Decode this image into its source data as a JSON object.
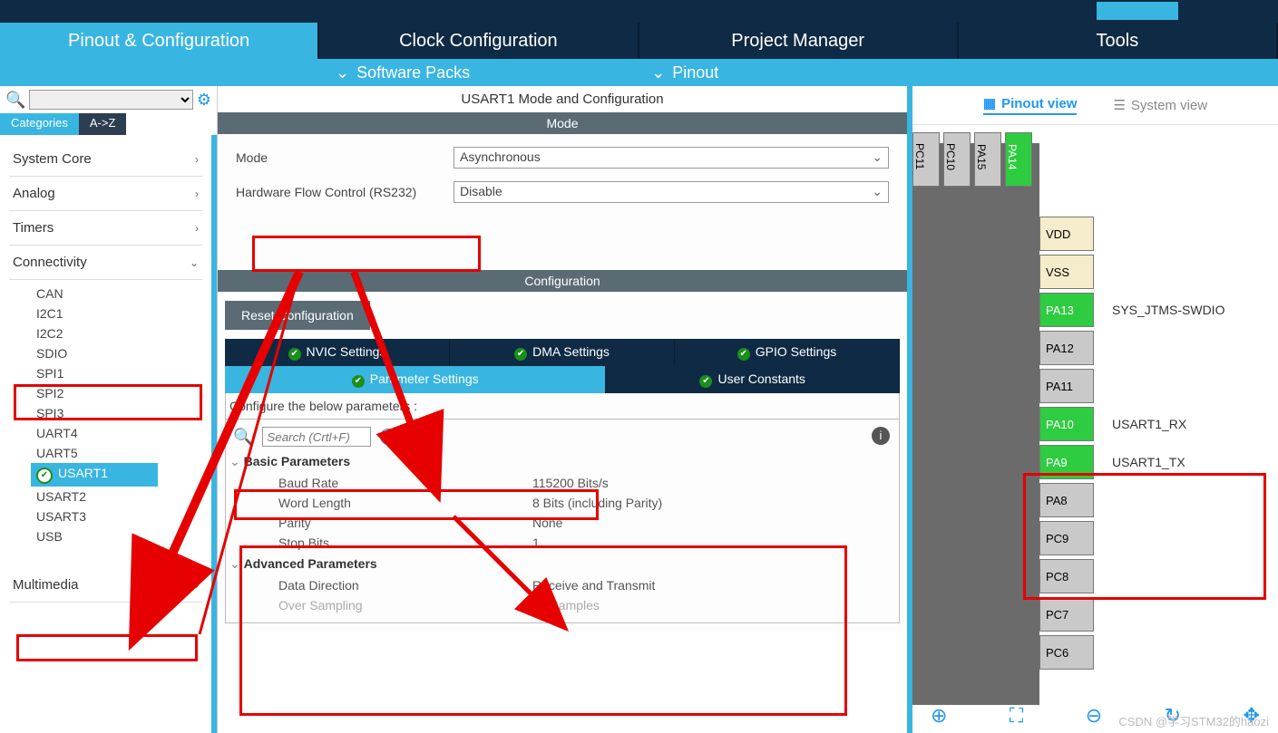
{
  "tabs": {
    "pinout": "Pinout & Configuration",
    "clock": "Clock Configuration",
    "project": "Project Manager",
    "tools": "Tools"
  },
  "subbar": {
    "software_packs": "Software Packs",
    "pinout": "Pinout"
  },
  "left": {
    "cat_tabs": {
      "categories": "Categories",
      "az": "A->Z"
    },
    "groups": {
      "system_core": "System Core",
      "analog": "Analog",
      "timers": "Timers",
      "connectivity": "Connectivity",
      "multimedia": "Multimedia"
    },
    "connectivity_items": [
      "CAN",
      "I2C1",
      "I2C2",
      "SDIO",
      "SPI1",
      "SPI2",
      "SPI3",
      "UART4",
      "UART5",
      "USART1",
      "USART2",
      "USART3",
      "USB"
    ]
  },
  "center": {
    "title": "USART1 Mode and Configuration",
    "mode_header": "Mode",
    "mode_label": "Mode",
    "mode_value": "Asynchronous",
    "hw_label": "Hardware Flow Control (RS232)",
    "hw_value": "Disable",
    "config_header": "Configuration",
    "reset_btn": "Reset Configuration",
    "cfg_tabs_row1": [
      "NVIC Settings",
      "DMA Settings",
      "GPIO Settings"
    ],
    "cfg_tabs_row2": [
      "Parameter Settings",
      "User Constants"
    ],
    "cfg_hint": "Configure the below parameters :",
    "search_placeholder": "Search (Crtl+F)",
    "groups": {
      "basic": {
        "title": "Basic Parameters",
        "rows": [
          {
            "name": "Baud Rate",
            "value": "115200 Bits/s"
          },
          {
            "name": "Word Length",
            "value": "8 Bits (including Parity)"
          },
          {
            "name": "Parity",
            "value": "None"
          },
          {
            "name": "Stop Bits",
            "value": "1"
          }
        ]
      },
      "advanced": {
        "title": "Advanced Parameters",
        "rows": [
          {
            "name": "Data Direction",
            "value": "Receive and Transmit"
          },
          {
            "name": "Over Sampling",
            "value": "16 Samples",
            "dim": true
          }
        ]
      }
    }
  },
  "right": {
    "pinout_view": "Pinout view",
    "system_view": "System view",
    "top_pins": [
      {
        "label": "PC11",
        "green": false
      },
      {
        "label": "PC10",
        "green": false
      },
      {
        "label": "PA15",
        "green": false
      },
      {
        "label": "PA14",
        "green": true
      }
    ],
    "side_pins": [
      {
        "label": "VDD",
        "cls": "yellow",
        "fn": ""
      },
      {
        "label": "VSS",
        "cls": "yellow",
        "fn": ""
      },
      {
        "label": "PA13",
        "cls": "green",
        "fn": "SYS_JTMS-SWDIO"
      },
      {
        "label": "PA12",
        "cls": "",
        "fn": ""
      },
      {
        "label": "PA11",
        "cls": "",
        "fn": ""
      },
      {
        "label": "PA10",
        "cls": "green",
        "fn": "USART1_RX"
      },
      {
        "label": "PA9",
        "cls": "green",
        "fn": "USART1_TX"
      },
      {
        "label": "PA8",
        "cls": "",
        "fn": ""
      },
      {
        "label": "PC9",
        "cls": "",
        "fn": ""
      },
      {
        "label": "PC8",
        "cls": "",
        "fn": ""
      },
      {
        "label": "PC7",
        "cls": "",
        "fn": ""
      },
      {
        "label": "PC6",
        "cls": "",
        "fn": ""
      }
    ]
  },
  "watermark": "CSDN @学习STM32的haozi"
}
